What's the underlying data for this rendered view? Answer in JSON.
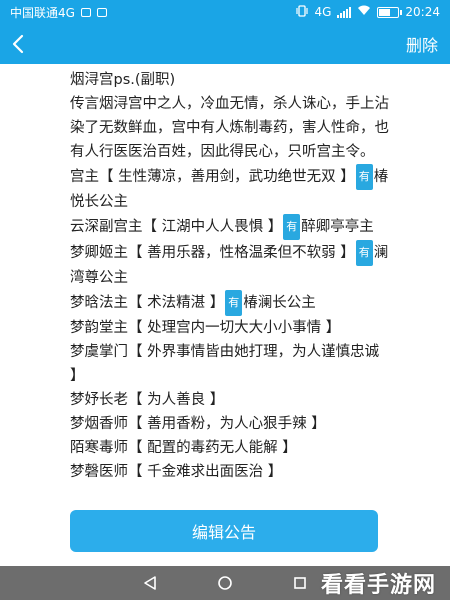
{
  "status_bar": {
    "carrier": "中国联通4G",
    "network": "4G",
    "battery_level": "53",
    "time": "20:24"
  },
  "nav": {
    "back_icon": "chevron-left-icon",
    "delete_label": "删除"
  },
  "notice": {
    "title": "烟浔宫ps.(副职)",
    "intro": "传言烟浔宫中之人，冷血无情，杀人诛心，手上沾染了无数鲜血，宫中有人炼制毒药，害人性命，也有人行医医治百姓，因此得民心，只听宫主令。",
    "you_badge": "有",
    "entries": [
      {
        "pre": "宫主【 生性薄凉，善用剑，武功绝世无双 】",
        "badge": true,
        "post": "椿悦长公主"
      },
      {
        "pre": "云深副宫主【 江湖中人人畏惧 】",
        "badge": true,
        "post": "醉卿亭亭主"
      },
      {
        "pre": "梦卿姬主【 善用乐器，性格温柔但不软弱 】",
        "badge": true,
        "post": "澜湾尊公主"
      },
      {
        "pre": "梦晗法主【 术法精湛 】",
        "badge": true,
        "post": "椿澜长公主"
      },
      {
        "pre": "梦韵堂主【 处理宫内一切大大小小事情 】",
        "badge": false,
        "post": ""
      },
      {
        "pre": "梦虞掌门【 外界事情皆由她打理，为人谨慎忠诚 】",
        "badge": false,
        "post": ""
      },
      {
        "pre": "梦妤长老【 为人善良 】",
        "badge": false,
        "post": ""
      },
      {
        "pre": "梦烟香师【 善用香粉，为人心狠手辣 】",
        "badge": false,
        "post": ""
      },
      {
        "pre": "陌寒毒师【 配置的毒药无人能解 】",
        "badge": false,
        "post": ""
      },
      {
        "pre": "梦磬医师【 千金难求出面医治 】",
        "badge": false,
        "post": ""
      }
    ]
  },
  "edit_button_label": "编辑公告",
  "system_nav": {
    "back_icon": "triangle-back-icon",
    "home_icon": "circle-home-icon",
    "recents_icon": "square-recents-icon"
  },
  "watermark": "看看手游网",
  "colors": {
    "header_blue": "#1aa5e6",
    "button_blue": "#2cadeb",
    "badge_blue": "#29a8e0",
    "sys_nav_gray": "#6d6d6d"
  }
}
